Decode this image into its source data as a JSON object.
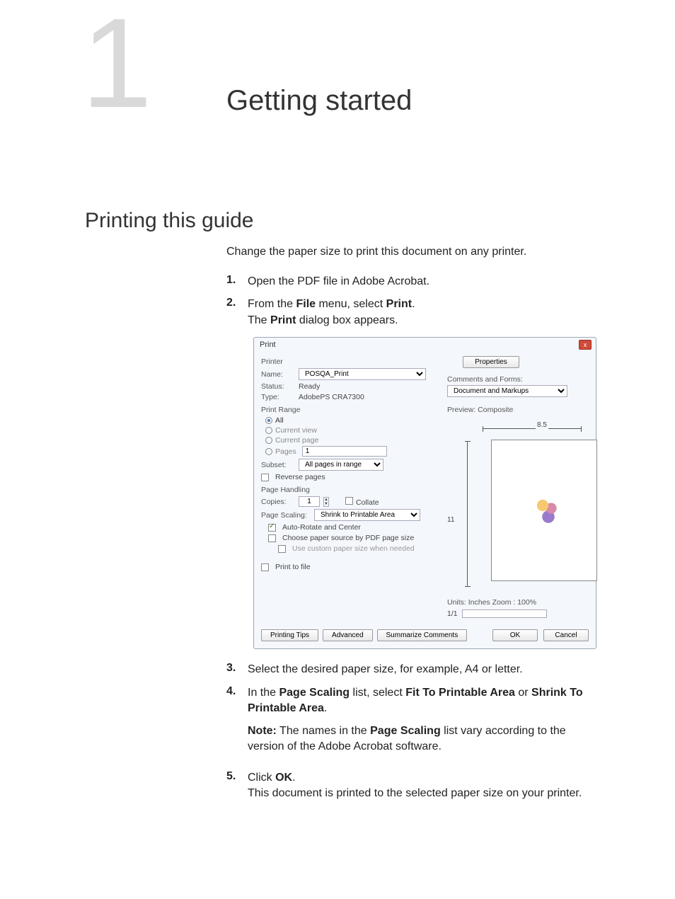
{
  "chapter": {
    "number": "1",
    "title": "Getting started"
  },
  "section": {
    "title": "Printing this guide",
    "intro": "Change the paper size to print this document on any printer."
  },
  "steps": {
    "s1_num": "1.",
    "s1": "Open the PDF file in Adobe Acrobat.",
    "s2_num": "2.",
    "s2_a": "From the ",
    "s2_b": "File",
    "s2_c": " menu, select ",
    "s2_d": "Print",
    "s2_e": ".",
    "s2_f": "The ",
    "s2_g": "Print",
    "s2_h": " dialog box appears.",
    "s3_num": "3.",
    "s3": "Select the desired paper size, for example, A4 or letter.",
    "s4_num": "4.",
    "s4_a": "In the ",
    "s4_b": "Page Scaling",
    "s4_c": " list, select ",
    "s4_d": "Fit To Printable Area",
    "s4_e": " or ",
    "s4_f": "Shrink To Printable Area",
    "s4_g": ".",
    "note_a": "Note:",
    "note_b": " The names in the ",
    "note_c": "Page Scaling",
    "note_d": " list vary according to the version of the Adobe Acrobat software.",
    "s5_num": "5.",
    "s5_a": "Click ",
    "s5_b": "OK",
    "s5_c": ".",
    "s5_d": "This document is printed to the selected paper size on your printer."
  },
  "dialog": {
    "title": "Print",
    "close_x": "x",
    "printer_hdr": "Printer",
    "name_lbl": "Name:",
    "name_val": "POSQA_Print",
    "status_lbl": "Status:",
    "status_val": "Ready",
    "type_lbl": "Type:",
    "type_val": "AdobePS CRA7300",
    "properties_btn": "Properties",
    "comments_lbl": "Comments and Forms:",
    "comments_val": "Document and Markups",
    "range_hdr": "Print Range",
    "range_all": "All",
    "range_view": "Current view",
    "range_page": "Current page",
    "range_pages": "Pages",
    "range_pages_val": "1",
    "subset_lbl": "Subset:",
    "subset_val": "All pages in range",
    "reverse": "Reverse pages",
    "handling_hdr": "Page Handling",
    "copies_lbl": "Copies:",
    "copies_val": "1",
    "collate": "Collate",
    "scaling_lbl": "Page Scaling:",
    "scaling_val": "Shrink to Printable Area",
    "autorotate": "Auto-Rotate and Center",
    "choose_src": "Choose paper source by PDF page size",
    "custom_size": "Use custom paper size when needed",
    "print_to_file": "Print to file",
    "preview_lbl": "Preview: Composite",
    "ruler_w": "8.5",
    "ruler_h": "11",
    "units": "Units: Inches Zoom : 100%",
    "progress": "1/1",
    "tips_btn": "Printing Tips",
    "advanced_btn": "Advanced",
    "summarize_btn": "Summarize Comments",
    "ok_btn": "OK",
    "cancel_btn": "Cancel"
  }
}
